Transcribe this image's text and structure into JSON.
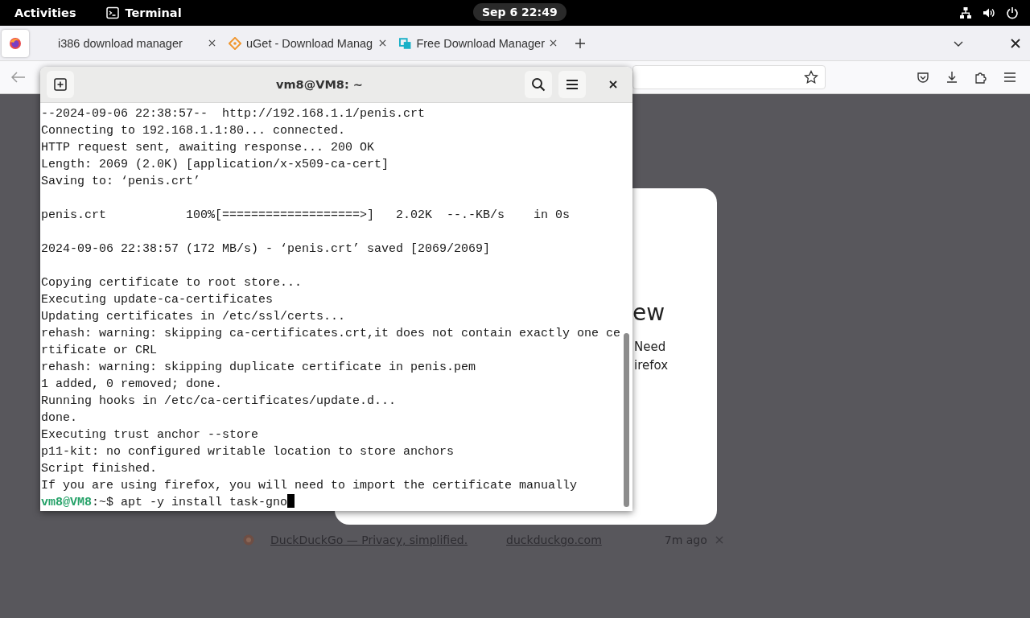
{
  "top_bar": {
    "activities": "Activities",
    "app_name": "Terminal",
    "clock": "Sep 6  22:49"
  },
  "browser": {
    "tabs": [
      {
        "kind": "pinned",
        "selected": true
      },
      {
        "kind": "normal",
        "label": "i386 download manager",
        "selected": false
      },
      {
        "kind": "normal",
        "label": "uGet - Download Manag",
        "selected": false
      },
      {
        "kind": "normal",
        "label": "Free Download Manager",
        "selected": false
      }
    ],
    "page_card": {
      "heading": "ew",
      "lines": [
        "Need",
        "irefox"
      ]
    },
    "history_row": {
      "title": "DuckDuckGo — Privacy, simplified.",
      "domain": "duckduckgo.com",
      "time": "7m ago"
    }
  },
  "terminal": {
    "title": "vm8@VM8: ~",
    "blocks": [
      [
        "--2024-09-06 22:38:57--  http://192.168.1.1/penis.crt",
        "Connecting to 192.168.1.1:80... connected.",
        "HTTP request sent, awaiting response... 200 OK",
        "Length: 2069 (2.0K) [application/x-x509-ca-cert]",
        "Saving to: ‘penis.crt’"
      ],
      [
        "penis.crt           100%[===================>]   2.02K  --.-KB/s    in 0s"
      ],
      [
        "2024-09-06 22:38:57 (172 MB/s) - ‘penis.crt’ saved [2069/2069]"
      ],
      [
        "Copying certificate to root store...",
        "Executing update-ca-certificates",
        "Updating certificates in /etc/ssl/certs...",
        "rehash: warning: skipping ca-certificates.crt,it does not contain exactly one ce",
        "rtificate or CRL",
        "rehash: warning: skipping duplicate certificate in penis.pem",
        "1 added, 0 removed; done.",
        "Running hooks in /etc/ca-certificates/update.d...",
        "done.",
        "Executing trust anchor --store",
        "p11-kit: no configured writable location to store anchors",
        "Script finished.",
        "If you are using firefox, you will need to import the certificate manually"
      ]
    ],
    "prompt": {
      "user_host": "vm8@VM8",
      "path_symbol": ":~$ ",
      "command": "apt -y install task-gno"
    }
  }
}
